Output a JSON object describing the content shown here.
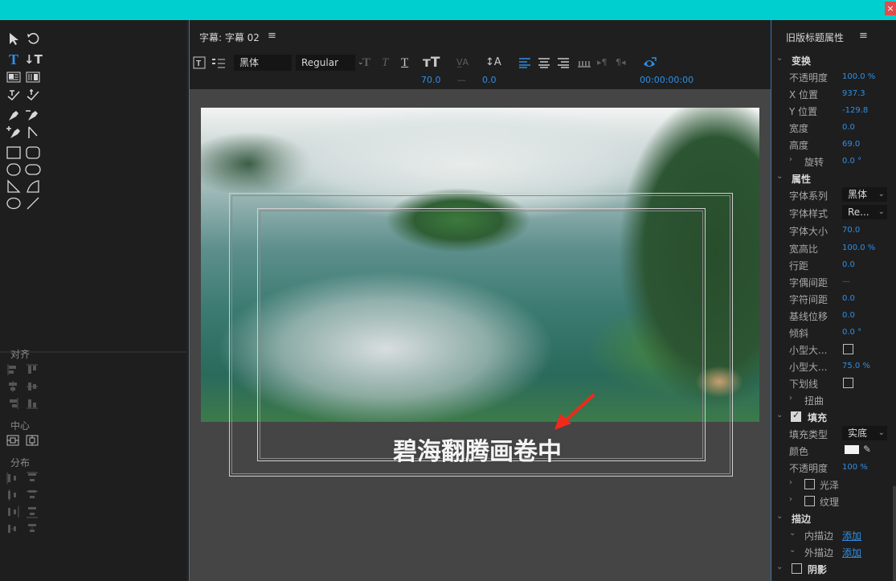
{
  "window": {
    "close_label": "×"
  },
  "toolbox": {
    "align_label": "对齐",
    "center_label": "中心",
    "distribute_label": "分布"
  },
  "editor": {
    "title": "字幕: 字幕 02",
    "menu_icon": "≡",
    "font_family": "黑体",
    "font_style": "Regular",
    "font_size": "70.0",
    "kerning_placeholder": "—",
    "tracking": "0.0",
    "timecode": "00:00:00:00",
    "subtitle_text": "碧海翻腾画卷中",
    "chev": "⌄"
  },
  "properties": {
    "title": "旧版标题属性",
    "menu_icon": "≡",
    "transform": {
      "label": "变换",
      "opacity_label": "不透明度",
      "opacity_value": "100.0 %",
      "x_label": "X 位置",
      "x_value": "937.3",
      "y_label": "Y 位置",
      "y_value": "-129.8",
      "width_label": "宽度",
      "width_value": "0.0",
      "height_label": "高度",
      "height_value": "69.0",
      "rotation_label": "旋转",
      "rotation_value": "0.0 °"
    },
    "attributes": {
      "label": "属性",
      "font_family_label": "字体系列",
      "font_family_value": "黑体",
      "font_style_label": "字体样式",
      "font_style_value": "Re...",
      "font_size_label": "字体大小",
      "font_size_value": "70.0",
      "aspect_label": "宽高比",
      "aspect_value": "100.0 %",
      "leading_label": "行距",
      "leading_value": "0.0",
      "kerning_label": "字偶间距",
      "kerning_value": "—",
      "tracking_label": "字符间距",
      "tracking_value": "0.0",
      "baseline_label": "基线位移",
      "baseline_value": "0.0",
      "slant_label": "倾斜",
      "slant_value": "0.0 °",
      "small_caps_label": "小型大...",
      "small_caps_size_label": "小型大...",
      "small_caps_size_value": "75.0 %",
      "underline_label": "下划线",
      "distort_label": "扭曲"
    },
    "fill": {
      "label": "填充",
      "fill_type_label": "填充类型",
      "fill_type_value": "实底",
      "color_label": "颜色",
      "color_value": "#f4f4f4",
      "opacity_label": "不透明度",
      "opacity_value": "100 %",
      "sheen_label": "光泽",
      "texture_label": "纹理"
    },
    "stroke": {
      "label": "描边",
      "inner_label": "内描边",
      "inner_action": "添加",
      "outer_label": "外描边",
      "outer_action": "添加"
    },
    "shadow": {
      "label": "阴影"
    }
  },
  "colors": {
    "accent": "#2f8fe7",
    "topbar": "#00cfcf",
    "close": "#e34c4c"
  }
}
